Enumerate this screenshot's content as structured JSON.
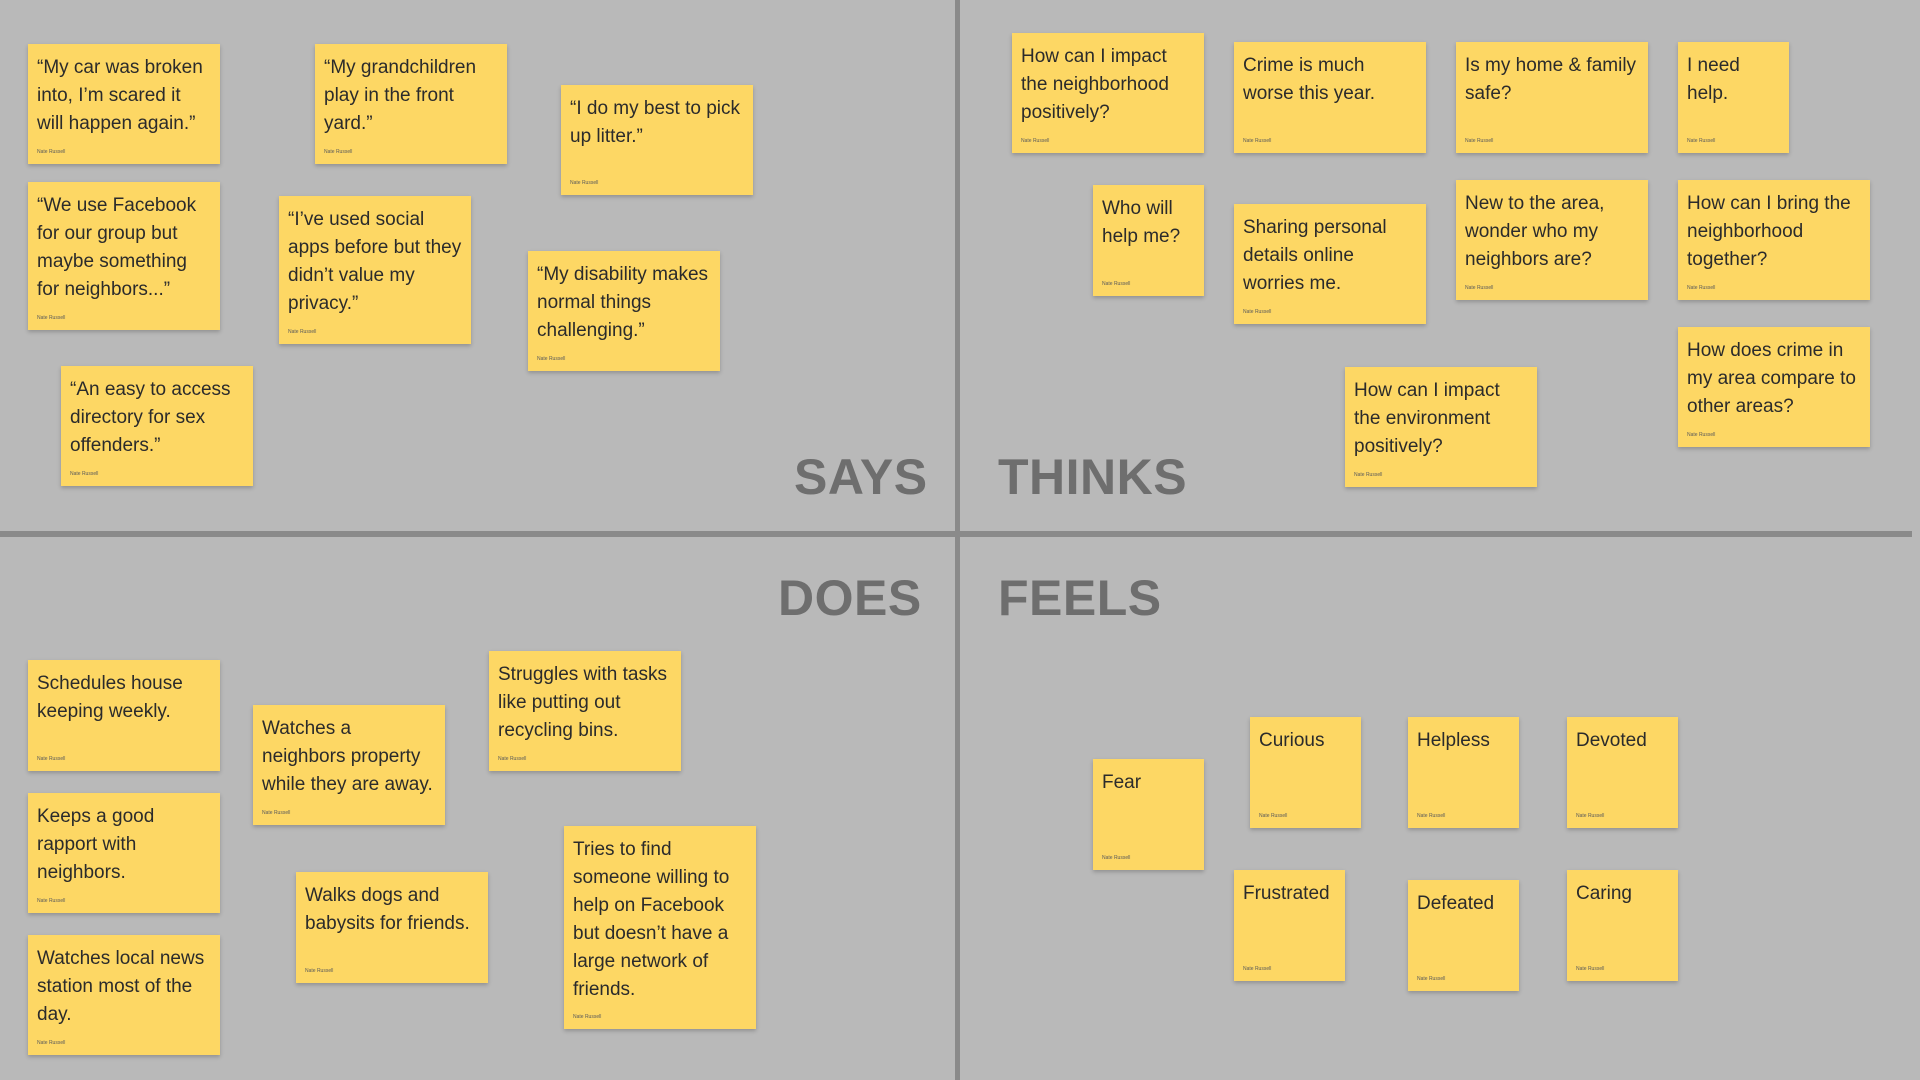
{
  "quadrants": {
    "says": "SAYS",
    "thinks": "THINKS",
    "does": "DOES",
    "feels": "FEELS"
  },
  "author": "Nate Russell",
  "colors": {
    "background": "#b9b9b9",
    "divider": "#8a8a8a",
    "note": "#fdd764",
    "label": "#6e6e6e"
  },
  "says": [
    "“My car was broken into, I’m scared it will happen again.”",
    "“My grandchildren play in the front yard.”",
    "“I do my best to pick up litter.”",
    "“We use Facebook for our group but maybe something for neighbors...”",
    "“I’ve used social apps before but they didn’t value my privacy.”",
    "“My disability makes normal things challenging.”",
    "“An easy to access directory for sex offenders.”"
  ],
  "thinks": [
    "How can I impact the neighborhood positively?",
    "Crime is much worse this year.",
    "Is my home & family safe?",
    "I need help.",
    "Who will help me?",
    "Sharing personal details online worries me.",
    "New to the area, wonder who my neighbors are?",
    "How can I bring the neighborhood together?",
    "How can I impact the environment positively?",
    "How does crime in my area compare to other areas?"
  ],
  "does": [
    "Schedules house keeping weekly.",
    "Watches a neighbors property while they are away.",
    "Struggles with tasks like putting out recycling bins.",
    "Keeps a good rapport with neighbors.",
    "Walks dogs and babysits for friends.",
    "Tries to find someone willing to help on Facebook but doesn’t have a large network of friends.",
    "Watches local news station most of the day."
  ],
  "feels": [
    "Fear",
    "Curious",
    "Helpless",
    "Devoted",
    "Frustrated",
    "Defeated",
    "Caring"
  ]
}
